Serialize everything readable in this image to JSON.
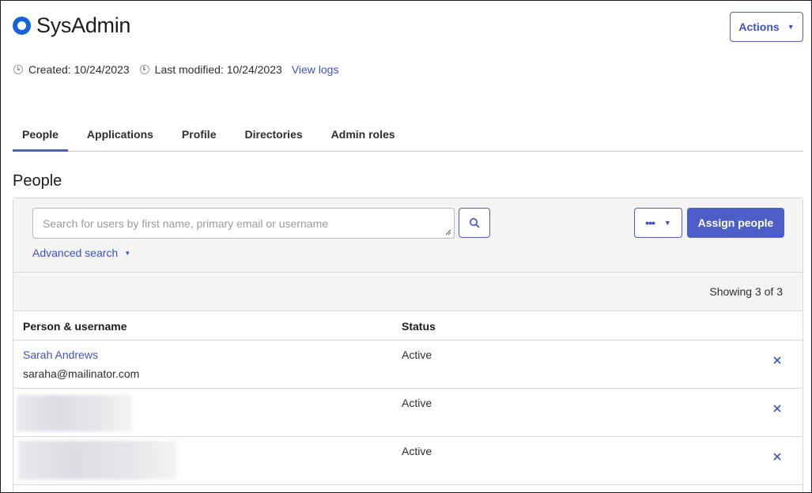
{
  "header": {
    "title": "SysAdmin",
    "actions_label": "Actions",
    "created": "Created: 10/24/2023",
    "last_modified": "Last modified: 10/24/2023",
    "view_logs": "View logs"
  },
  "tabs": [
    {
      "label": "People",
      "active": true
    },
    {
      "label": "Applications",
      "active": false
    },
    {
      "label": "Profile",
      "active": false
    },
    {
      "label": "Directories",
      "active": false
    },
    {
      "label": "Admin roles",
      "active": false
    }
  ],
  "section": {
    "title": "People"
  },
  "toolbar": {
    "search_placeholder": "Search for users by first name, primary email or username",
    "advanced_search": "Advanced search",
    "assign_label": "Assign people",
    "more_label": "•••"
  },
  "count": "Showing 3 of 3",
  "table": {
    "columns": [
      "Person & username",
      "Status"
    ],
    "rows": [
      {
        "name": "Sarah Andrews",
        "email": "saraha@mailinator.com",
        "status": "Active"
      },
      {
        "name": "",
        "email": "",
        "status": "Active"
      },
      {
        "name": "",
        "email": "",
        "status": "Active"
      }
    ]
  },
  "colors": {
    "accent": "#4d5ec9",
    "brand_icon": "#1662dd",
    "toolbar_bg": "#f4f4f5"
  }
}
